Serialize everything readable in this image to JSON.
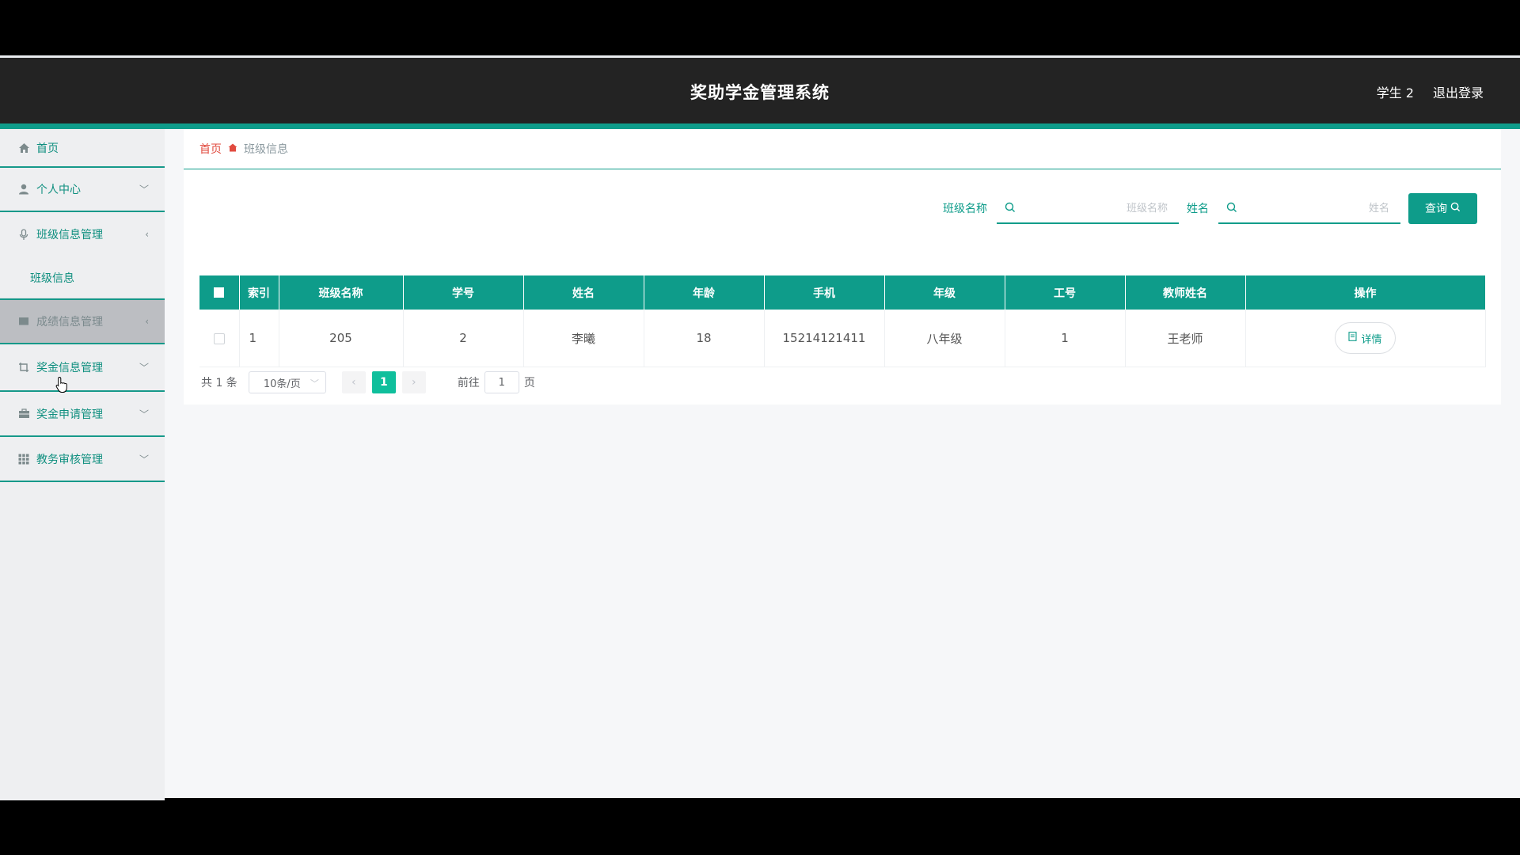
{
  "header": {
    "title": "奖助学金管理系统",
    "user": "学生 2",
    "logout": "退出登录"
  },
  "sidebar": {
    "items": [
      {
        "label": "首页",
        "icon": "home-icon"
      },
      {
        "label": "个人中心",
        "icon": "user-icon"
      },
      {
        "label": "班级信息管理",
        "icon": "microphone-icon"
      },
      {
        "label": "成绩信息管理",
        "icon": "book-icon"
      },
      {
        "label": "奖金信息管理",
        "icon": "crop-icon"
      },
      {
        "label": "奖金申请管理",
        "icon": "briefcase-icon"
      },
      {
        "label": "教务审核管理",
        "icon": "grid-icon"
      }
    ],
    "submenu": {
      "label": "班级信息"
    }
  },
  "breadcrumb": {
    "home": "首页",
    "current": "班级信息"
  },
  "search": {
    "class_label": "班级名称",
    "class_placeholder": "班级名称",
    "name_label": "姓名",
    "name_placeholder": "姓名",
    "button": "查询"
  },
  "table": {
    "headers": [
      "索引",
      "班级名称",
      "学号",
      "姓名",
      "年龄",
      "手机",
      "年级",
      "工号",
      "教师姓名",
      "操作"
    ],
    "rows": [
      {
        "index": "1",
        "class_name": "205",
        "student_no": "2",
        "name": "李曦",
        "age": "18",
        "phone": "15214121411",
        "grade": "八年级",
        "staff_no": "1",
        "teacher": "王老师",
        "action": "详情"
      }
    ]
  },
  "pagination": {
    "total": "共 1 条",
    "page_size": "10条/页",
    "current_page": "1",
    "goto_label": "前往",
    "goto_value": "1",
    "page_unit": "页"
  },
  "colors": {
    "accent": "#0e9c8a",
    "header": "#232323",
    "active_page": "#0fbf9c"
  }
}
